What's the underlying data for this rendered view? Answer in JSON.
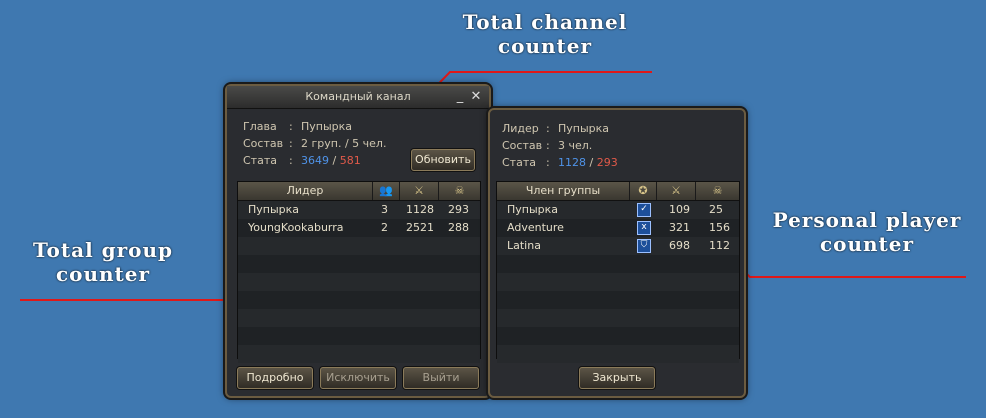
{
  "annotations": {
    "total_channel": "Total channel\ncounter",
    "total_group": "Total group\ncounter",
    "personal_player": "Personal player\ncounter"
  },
  "left_window": {
    "title": "Командный канал",
    "leader_label": "Глава",
    "leader_value": "Пупырка",
    "composition_label": "Состав",
    "composition_value": "2 груп. / 5 чел.",
    "stats_label": "Стата",
    "stats_blue": "3649",
    "stats_slash": " / ",
    "stats_red": "581",
    "refresh_button": "Обновить",
    "columns": [
      "Лидер"
    ],
    "rows": [
      {
        "name": "Пупырка",
        "count": "3",
        "kills": "1128",
        "deaths": "293"
      },
      {
        "name": "YoungKookaburra",
        "count": "2",
        "kills": "2521",
        "deaths": "288"
      }
    ],
    "buttons": {
      "details": "Подробно",
      "exclude": "Исключить",
      "leave": "Выйти"
    }
  },
  "right_window": {
    "leader_label": "Лидер",
    "leader_value": "Пупырка",
    "composition_label": "Состав",
    "composition_value": "3 чел.",
    "stats_label": "Стата",
    "stats_blue": "1128",
    "stats_slash": " / ",
    "stats_red": "293",
    "columns": [
      "Член группы"
    ],
    "rows": [
      {
        "name": "Пупырка",
        "class_icon": "sword-class-icon",
        "kills": "109",
        "deaths": "25"
      },
      {
        "name": "Adventure",
        "class_icon": "mage-class-icon",
        "kills": "321",
        "deaths": "156"
      },
      {
        "name": "Latina",
        "class_icon": "shield-class-icon",
        "kills": "698",
        "deaths": "112"
      }
    ],
    "close_button": "Закрыть"
  },
  "colors": {
    "background": "#3f78b0",
    "annotation_line": "#e01010",
    "blue_stat": "#4f93e8",
    "red_stat": "#e15a4a"
  }
}
